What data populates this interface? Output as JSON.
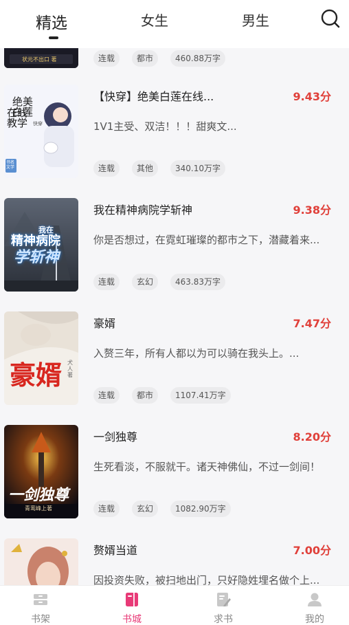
{
  "tabs": [
    {
      "label": "精选",
      "active": true
    },
    {
      "label": "女生",
      "active": false
    },
    {
      "label": "男生",
      "active": false
    }
  ],
  "accent_color": "#e83a77",
  "score_color": "#e0403a",
  "partial_book": {
    "cover_text": "状元不出口 著",
    "tags": [
      "连载",
      "都市",
      "460.88万字"
    ]
  },
  "books": [
    {
      "title": "【快穿】绝美白莲在线...",
      "score": "9.43分",
      "desc": "1V1主受、双洁！！！甜爽文...",
      "tags": [
        "连载",
        "其他",
        "340.10万字"
      ],
      "cover_text": [
        "绝美白莲",
        "在线教学",
        "快穿"
      ],
      "cover_badge": "书名文学"
    },
    {
      "title": "我在精神病院学斩神",
      "score": "9.38分",
      "desc": "你是否想过，在霓虹璀璨的都市之下，潜藏着来...",
      "tags": [
        "连载",
        "玄幻",
        "463.83万字"
      ],
      "cover_text": [
        "我在",
        "精神病院",
        "学斩神"
      ]
    },
    {
      "title": "豪婿",
      "score": "7.47分",
      "desc": "入赘三年，所有人都以为可以骑在我头上。...",
      "tags": [
        "连载",
        "都市",
        "1107.41万字"
      ],
      "cover_text": [
        "豪婿",
        "犬人著"
      ]
    },
    {
      "title": "一剑独尊",
      "score": "8.20分",
      "desc": "生死看淡，不服就干。诸天神佛仙，不过一剑间！",
      "tags": [
        "连载",
        "玄幻",
        "1082.90万字"
      ],
      "cover_text": [
        "一剑独尊",
        "青鸾峰上著"
      ]
    },
    {
      "title": "赘婿当道",
      "score": "7.00分",
      "desc": "因投资失败，被扫地出门，只好隐姓埋名做个上...",
      "tags": [],
      "cover_text": []
    }
  ],
  "bottom_nav": [
    {
      "label": "书架",
      "icon": "bookshelf-icon",
      "active": false
    },
    {
      "label": "书城",
      "icon": "bookstore-icon",
      "active": true
    },
    {
      "label": "求书",
      "icon": "request-book-icon",
      "active": false
    },
    {
      "label": "我的",
      "icon": "profile-icon",
      "active": false
    }
  ]
}
